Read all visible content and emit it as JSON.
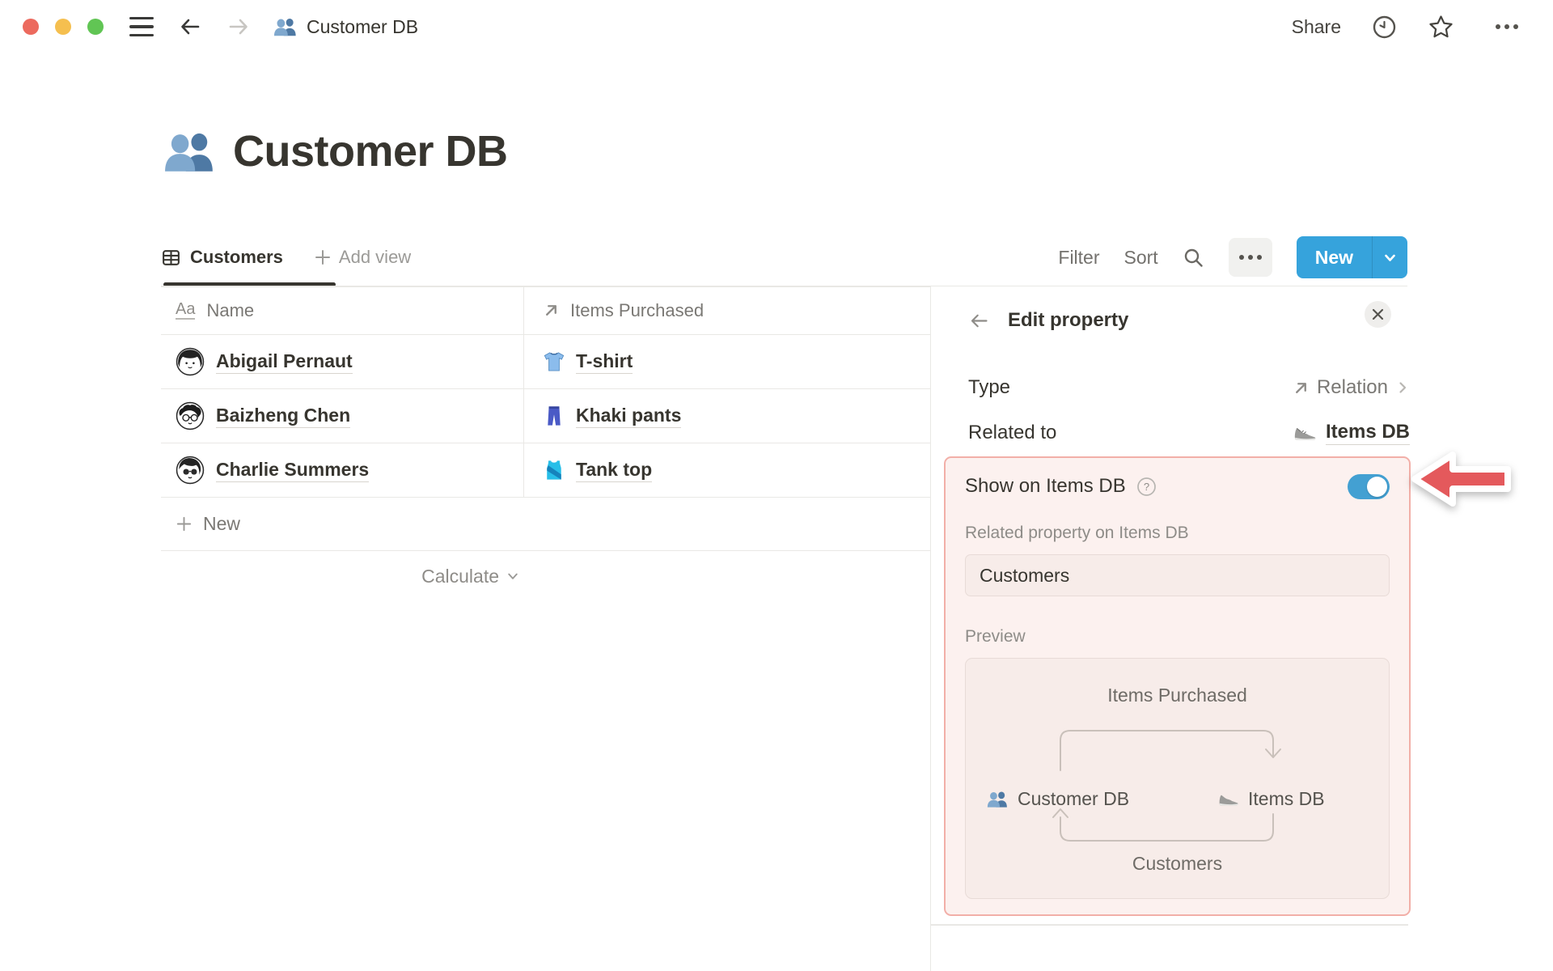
{
  "titlebar": {
    "breadcrumb": "Customer DB",
    "share": "Share"
  },
  "page": {
    "title": "Customer DB"
  },
  "view_toolbar": {
    "active_view": "Customers",
    "add_view": "Add view",
    "filter": "Filter",
    "sort": "Sort",
    "new": "New"
  },
  "table": {
    "columns": [
      {
        "label": "Name",
        "icon": "text-property-icon",
        "icon_glyph": "Aa"
      },
      {
        "label": "Items Purchased",
        "icon": "relation-arrow-icon"
      }
    ],
    "rows": [
      {
        "name": "Abigail Pernaut",
        "item": "T-shirt",
        "item_icon": "tshirt-icon"
      },
      {
        "name": "Baizheng Chen",
        "item": "Khaki pants",
        "item_icon": "jeans-icon"
      },
      {
        "name": "Charlie Summers",
        "item": "Tank top",
        "item_icon": "tank-top-icon"
      }
    ],
    "new_row": "New",
    "calculate": "Calculate"
  },
  "panel": {
    "title": "Edit property",
    "type_label": "Type",
    "type_value": "Relation",
    "related_label": "Related to",
    "related_value": "Items DB",
    "show_on_label": "Show on Items DB",
    "toggle_on": true,
    "related_property_label": "Related property on Items DB",
    "related_property_value": "Customers",
    "preview_label": "Preview",
    "preview": {
      "top_relation": "Items Purchased",
      "left_db": "Customer DB",
      "right_db": "Items DB",
      "bottom_relation": "Customers"
    }
  },
  "colors": {
    "accent_blue": "#36A3DC",
    "toggle_blue": "#43A0D2",
    "highlight_border": "#F2AFA8",
    "highlight_bg": "#FCF1EF",
    "annotation_arrow_red": "#E4595C"
  }
}
